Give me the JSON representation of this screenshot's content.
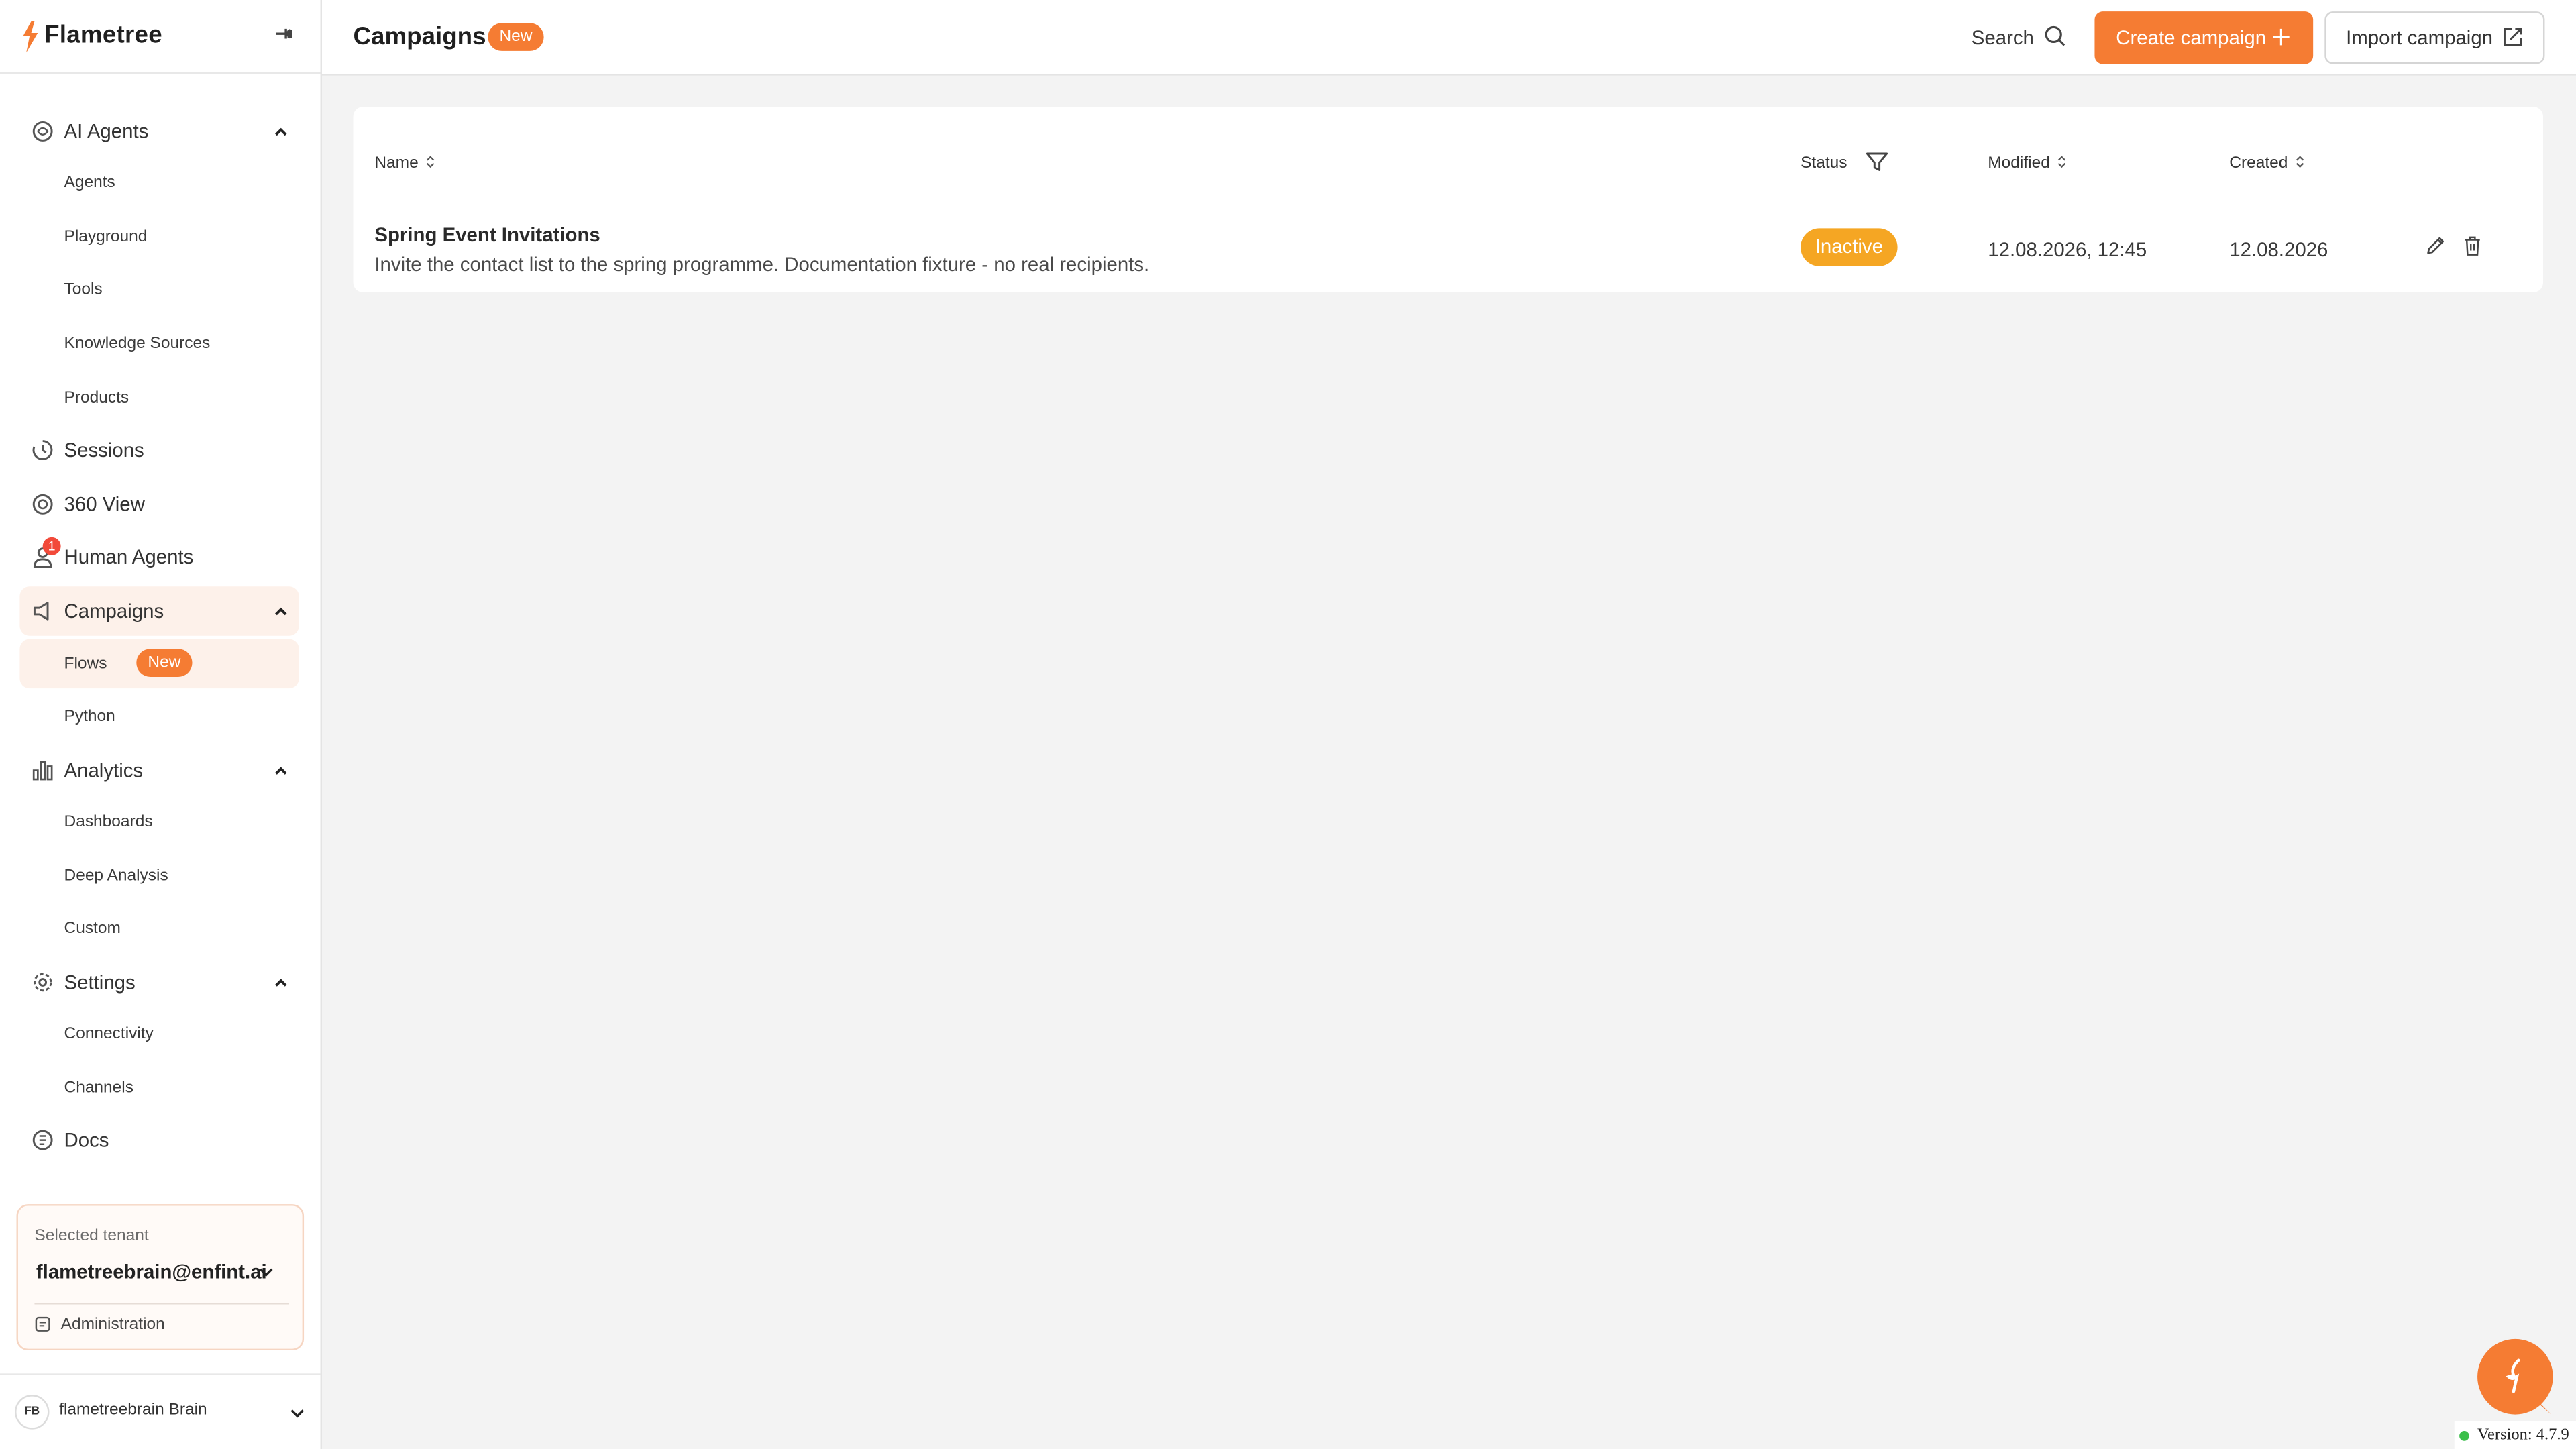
{
  "brand": {
    "name": "Flametree"
  },
  "sidebar": {
    "sections": [
      {
        "label": "AI Agents",
        "icon": "ai-agents-icon",
        "sub": [
          "Agents",
          "Playground",
          "Tools",
          "Knowledge Sources",
          "Products"
        ]
      },
      {
        "label": "Sessions",
        "icon": "sessions-icon"
      },
      {
        "label": "360 View",
        "icon": "view-360-icon"
      },
      {
        "label": "Human Agents",
        "icon": "human-agents-icon",
        "notification": "1"
      },
      {
        "label": "Campaigns",
        "icon": "campaigns-icon",
        "active": true,
        "sub": [
          "Flows",
          "Python"
        ],
        "sub_badge": "New"
      },
      {
        "label": "Analytics",
        "icon": "analytics-icon",
        "sub": [
          "Dashboards",
          "Deep Analysis",
          "Custom"
        ]
      },
      {
        "label": "Settings",
        "icon": "settings-icon",
        "sub": [
          "Connectivity",
          "Channels"
        ]
      },
      {
        "label": "Docs",
        "icon": "docs-icon"
      }
    ],
    "labels": {
      "ai_agents": "AI Agents",
      "agents": "Agents",
      "playground": "Playground",
      "tools": "Tools",
      "knowledge_sources": "Knowledge Sources",
      "products": "Products",
      "sessions": "Sessions",
      "view360": "360 View",
      "human_agents": "Human Agents",
      "human_agents_notif": "1",
      "campaigns": "Campaigns",
      "flows": "Flows",
      "flows_badge": "New",
      "python": "Python",
      "analytics": "Analytics",
      "dashboards": "Dashboards",
      "deep_analysis": "Deep Analysis",
      "custom": "Custom",
      "settings": "Settings",
      "connectivity": "Connectivity",
      "channels": "Channels",
      "docs": "Docs"
    },
    "tenant": {
      "label": "Selected tenant",
      "value": "flametreebrain@enfint.ai",
      "admin": "Administration"
    },
    "user": {
      "initials": "FB",
      "name": "flametreebrain Brain"
    }
  },
  "header": {
    "title": "Campaigns",
    "badge": "New",
    "search_label": "Search",
    "create_label": "Create campaign",
    "import_label": "Import campaign"
  },
  "table": {
    "columns": {
      "name": "Name",
      "status": "Status",
      "modified": "Modified",
      "created": "Created"
    },
    "rows": [
      {
        "name": "Spring Event Invitations",
        "description": "Invite the contact list to the spring programme. Documentation fixture - no real recipients.",
        "status": "Inactive",
        "modified": "12.08.2026, 12:45",
        "created": "12.08.2026"
      }
    ]
  },
  "footer": {
    "version": "Version: 4.7.9"
  },
  "colors": {
    "accent": "#f57c33",
    "status_inactive": "#f5a623",
    "active_bg": "#fdf1ea"
  }
}
